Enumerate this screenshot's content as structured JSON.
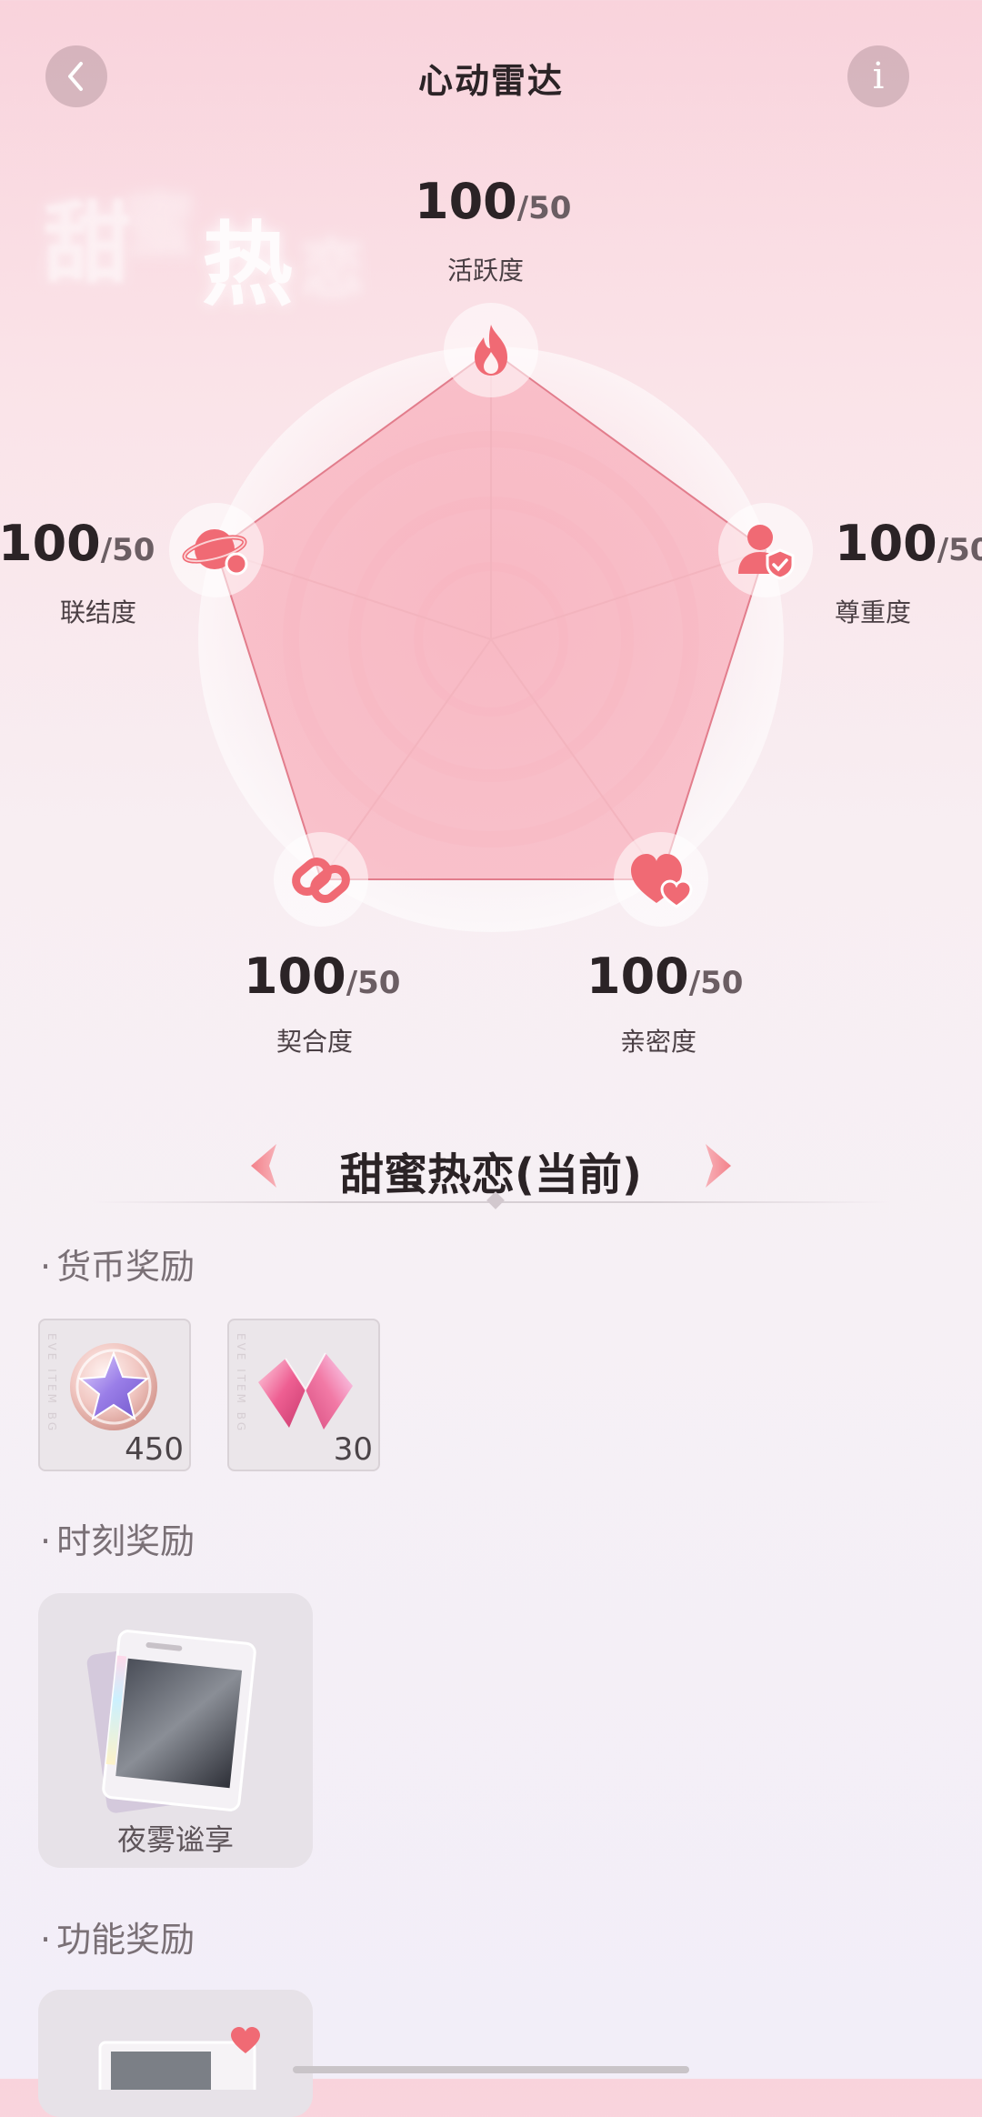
{
  "header": {
    "title": "心动雷达",
    "back_icon": "chevron-left-icon",
    "info_label": "i"
  },
  "watermark": {
    "c1": "甜",
    "c2": "蜜",
    "c3": "热",
    "c4": "恋"
  },
  "radar": {
    "accent": "#f07078",
    "max_value": 50,
    "stats": [
      {
        "key": "activity",
        "value": "100",
        "max": "/50",
        "label": "活跃度",
        "icon": "flame-icon"
      },
      {
        "key": "respect",
        "value": "100",
        "max": "/50",
        "label": "尊重度",
        "icon": "user-shield-icon"
      },
      {
        "key": "intimacy",
        "value": "100",
        "max": "/50",
        "label": "亲密度",
        "icon": "hearts-icon"
      },
      {
        "key": "compatibility",
        "value": "100",
        "max": "/50",
        "label": "契合度",
        "icon": "link-icon"
      },
      {
        "key": "connection",
        "value": "100",
        "max": "/50",
        "label": "联结度",
        "icon": "planet-icon"
      }
    ]
  },
  "level": {
    "title": "甜蜜热恋(当前)",
    "prev_icon": "arrow-left-icon",
    "next_icon": "arrow-right-icon"
  },
  "sections": {
    "currency": "货币奖励",
    "moment": "时刻奖励",
    "feature": "功能奖励",
    "dot": "·"
  },
  "currency_rewards": [
    {
      "name": "star-coin-icon",
      "count": "450"
    },
    {
      "name": "crystal-icon",
      "count": "30"
    }
  ],
  "moment_rewards": [
    {
      "label": "夜雾谧享",
      "icon": "photo-card-icon"
    }
  ]
}
